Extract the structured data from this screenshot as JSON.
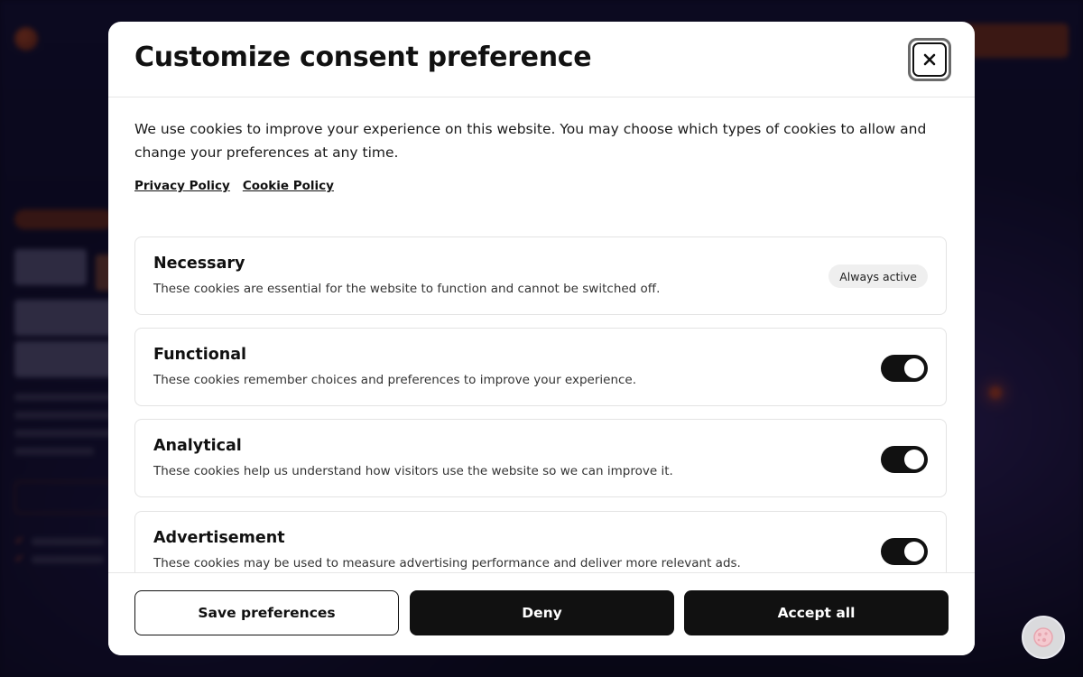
{
  "modal": {
    "title": "Customize consent preference",
    "close_label": "×",
    "intro": "We use cookies to improve your experience on this website. You may choose which types of cookies to allow and change your preferences at any time.",
    "links": [
      {
        "label": "Privacy Policy"
      },
      {
        "label": "Cookie Policy"
      }
    ],
    "categories": [
      {
        "title": "Necessary",
        "description": "These cookies are essential for the website to function and cannot be switched off.",
        "status": "Always active"
      },
      {
        "title": "Functional",
        "description": "These cookies remember choices and preferences to improve your experience.",
        "enabled": true
      },
      {
        "title": "Analytical",
        "description": "These cookies help us understand how visitors use the website so we can improve it.",
        "enabled": true
      },
      {
        "title": "Advertisement",
        "description": "These cookies may be used to measure advertising performance and deliver more relevant ads.",
        "enabled": true
      }
    ],
    "footer": {
      "save_label": "Save preferences",
      "deny_label": "Deny",
      "accept_label": "Accept all"
    }
  },
  "icons": {
    "close": "close-icon",
    "floating_widget": "cookie-settings-icon"
  },
  "colors": {
    "primary": "#111111",
    "surface": "#ffffff",
    "border": "#e3e3e3",
    "badge_bg": "#efefef",
    "overlay": "#0c0a1c"
  }
}
